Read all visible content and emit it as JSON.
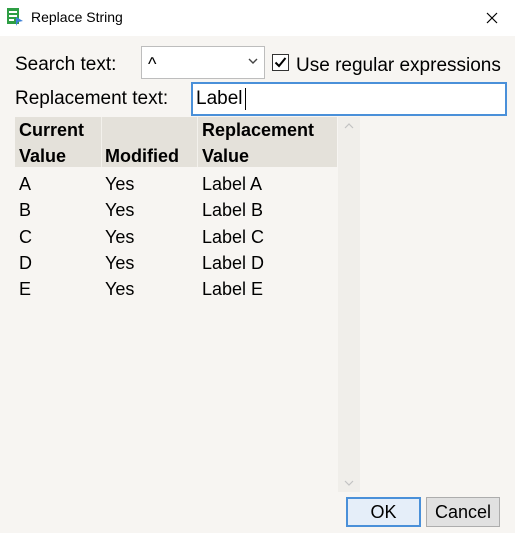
{
  "window": {
    "title": "Replace String"
  },
  "search": {
    "label": "Search text:",
    "value": "^"
  },
  "regex": {
    "label": "Use regular expressions",
    "checked": true
  },
  "replacement": {
    "label": "Replacement text:",
    "value": "Label "
  },
  "table": {
    "headers": [
      {
        "line1": "Current",
        "line2": "Value"
      },
      {
        "line1": "",
        "line2": "Modified"
      },
      {
        "line1": "Replacement",
        "line2": "Value"
      }
    ],
    "rows": [
      [
        "A",
        "Yes",
        "Label A"
      ],
      [
        "B",
        "Yes",
        "Label B"
      ],
      [
        "C",
        "Yes",
        "Label C"
      ],
      [
        "D",
        "Yes",
        "Label D"
      ],
      [
        "E",
        "Yes",
        "Label E"
      ]
    ]
  },
  "buttons": {
    "ok": "OK",
    "cancel": "Cancel"
  },
  "colors": {
    "focus": "#4a90d9",
    "header_bg": "#e4e1da",
    "dialog_bg": "#f7f5f2",
    "icon_green": "#2e9e44"
  }
}
